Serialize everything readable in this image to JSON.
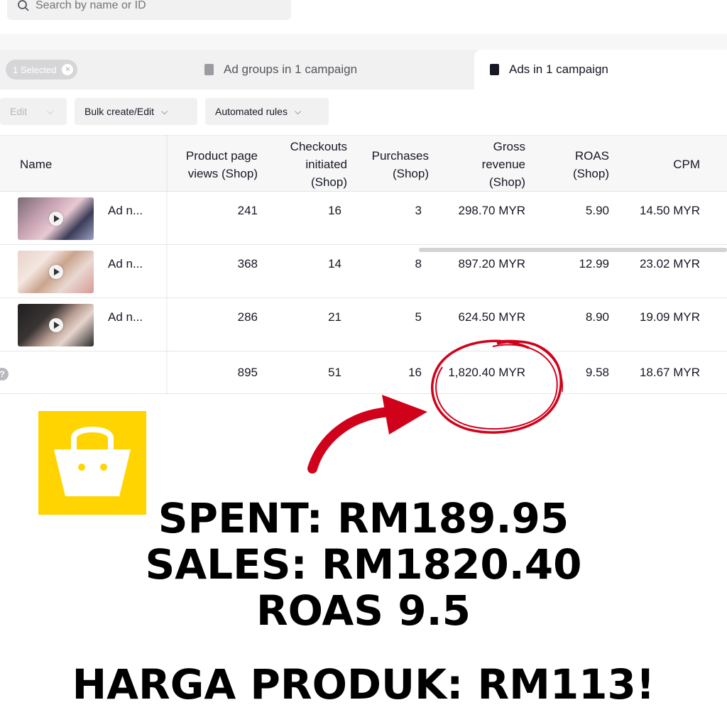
{
  "search": {
    "placeholder": "Search by name or ID"
  },
  "selection": {
    "chip_label": "1 Selected"
  },
  "tabs": [
    {
      "label": "Ad groups in 1 campaign",
      "icon": "document-icon"
    },
    {
      "label": "Ads in 1 campaign",
      "icon": "document-icon"
    }
  ],
  "toolbar": {
    "edit_label": "Edit",
    "bulk_label": "Bulk create/Edit",
    "rules_label": "Automated rules"
  },
  "table": {
    "headers": {
      "name": "Name",
      "ppv": [
        "Product page",
        "views (Shop)"
      ],
      "checkouts": [
        "Checkouts",
        "initiated",
        "(Shop)"
      ],
      "purchases": [
        "Purchases",
        "(Shop)"
      ],
      "gross": [
        "Gross",
        "revenue",
        "(Shop)"
      ],
      "roas": [
        "ROAS",
        "(Shop)"
      ],
      "cpm": "CPM"
    },
    "rows": [
      {
        "name": "Ad n...",
        "ppv": "241",
        "checkouts": "16",
        "purchases": "3",
        "gross": "298.70 MYR",
        "roas": "5.90",
        "cpm": "14.50 MYR"
      },
      {
        "name": "Ad n...",
        "ppv": "368",
        "checkouts": "14",
        "purchases": "8",
        "gross": "897.20 MYR",
        "roas": "12.99",
        "cpm": "23.02 MYR"
      },
      {
        "name": "Ad n...",
        "ppv": "286",
        "checkouts": "21",
        "purchases": "5",
        "gross": "624.50 MYR",
        "roas": "8.90",
        "cpm": "19.09 MYR"
      }
    ],
    "totals": {
      "ppv": "895",
      "checkouts": "51",
      "purchases": "16",
      "gross": "1,820.40 MYR",
      "roas": "9.58",
      "cpm": "18.67 MYR"
    }
  },
  "overlay": {
    "line1": "SPENT: RM189.95",
    "line2": "SALES: RM1820.40",
    "line3": "ROAS 9.5",
    "line4": "HARGA PRODUK: RM113!",
    "accent_color": "#d0021b",
    "logo_color": "#ffd400",
    "logo_icon": "shopping-bag-icon"
  }
}
